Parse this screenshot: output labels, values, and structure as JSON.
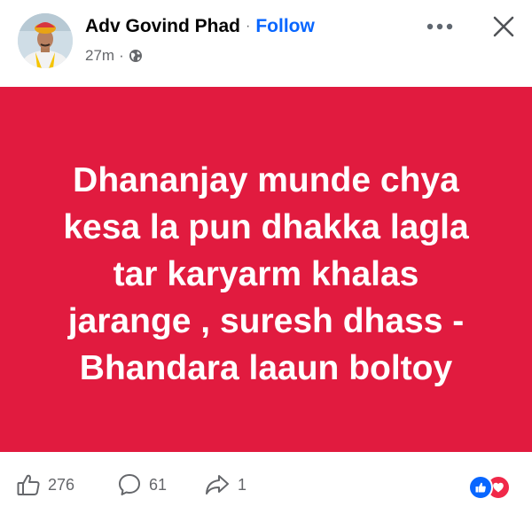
{
  "post": {
    "author": "Adv Govind Phad",
    "separator": "·",
    "follow_label": "Follow",
    "time": "27m",
    "privacy_icon": "globe-icon",
    "background_color": "#e11b3f",
    "text_lines": [
      "Dhananjay munde chya",
      "kesa la pun dhakka lagla",
      "tar karyarm khalas",
      "jarange , suresh dhass -",
      "Bhandara laaun boltoy"
    ]
  },
  "header_actions": {
    "more_icon": "more-horizontal-icon",
    "close_icon": "close-icon"
  },
  "footer": {
    "likes": "276",
    "comments": "61",
    "shares": "1",
    "like_icon": "thumbs-up-icon",
    "comment_icon": "comment-icon",
    "share_icon": "share-icon",
    "reaction_icons": [
      "like-reaction-icon",
      "love-reaction-icon"
    ]
  },
  "colors": {
    "accent": "#0866ff",
    "love": "#f02849"
  }
}
